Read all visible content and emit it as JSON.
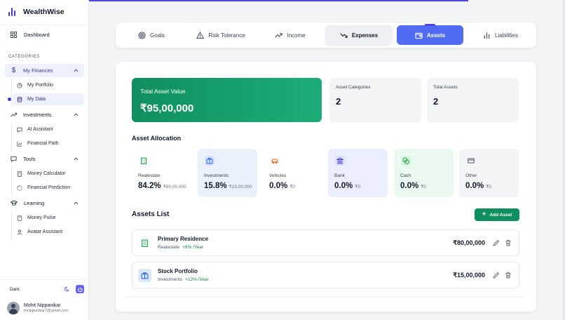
{
  "brand": {
    "name": "WealthWise"
  },
  "sidebar": {
    "dashboard": "Dashboard",
    "categories_label": "CATEGORIES",
    "groups": [
      {
        "label": "My Finances",
        "items": [
          "My Portfolio",
          "My Data"
        ]
      },
      {
        "label": "Investments",
        "items": [
          "AI Assistant",
          "Financial Path"
        ]
      },
      {
        "label": "Tools",
        "items": [
          "Money Calculator",
          "Financial Prediction"
        ]
      },
      {
        "label": "Learning",
        "items": [
          "Money Pulse",
          "Avatar Assistant"
        ]
      }
    ],
    "theme_label": "Dark",
    "user": {
      "name": "Mohit Nippanikar",
      "email": "mnippanikar7@gmail.com"
    }
  },
  "tabs": [
    {
      "label": "Goals",
      "icon": "target-icon"
    },
    {
      "label": "Risk Tolerance",
      "icon": "warning-icon"
    },
    {
      "label": "Income",
      "icon": "trend-up-icon"
    },
    {
      "label": "Expenses",
      "icon": "trend-down-icon"
    },
    {
      "label": "Assets",
      "icon": "wallet-icon"
    },
    {
      "label": "Liabilities",
      "icon": "bar-chart-icon"
    }
  ],
  "summary": {
    "total_label": "Total Asset Value",
    "total_value": "₹95,00,000",
    "categories_label": "Asset Categories",
    "categories_value": "2",
    "total_assets_label": "Total Assets",
    "total_assets_value": "2"
  },
  "allocation": {
    "title": "Asset Allocation",
    "items": [
      {
        "name": "Realestate",
        "pct": "84.2%",
        "amount": "₹80,00,000",
        "icon": "building-icon"
      },
      {
        "name": "Investments",
        "pct": "15.8%",
        "amount": "₹15,00,000",
        "icon": "briefcase-icon"
      },
      {
        "name": "Vehicles",
        "pct": "0.0%",
        "amount": "₹0",
        "icon": "car-icon"
      },
      {
        "name": "Bank",
        "pct": "0.0%",
        "amount": "₹0",
        "icon": "bank-icon"
      },
      {
        "name": "Cash",
        "pct": "0.0%",
        "amount": "₹0",
        "icon": "coins-icon"
      },
      {
        "name": "Other",
        "pct": "0.0%",
        "amount": "₹0",
        "icon": "card-icon"
      }
    ]
  },
  "assets_list": {
    "title": "Assets List",
    "add_label": "Add Asset",
    "rows": [
      {
        "name": "Primary Residence",
        "category": "Realestate",
        "growth": "+8% /Year",
        "amount": "₹80,00,000"
      },
      {
        "name": "Stock Portfolio",
        "category": "Investments",
        "growth": "+12% /Year",
        "amount": "₹15,00,000"
      }
    ]
  },
  "colors": {
    "accent": "#4f46e5",
    "active_tab": "#4f6cf3",
    "green": "#0f8f5f"
  }
}
